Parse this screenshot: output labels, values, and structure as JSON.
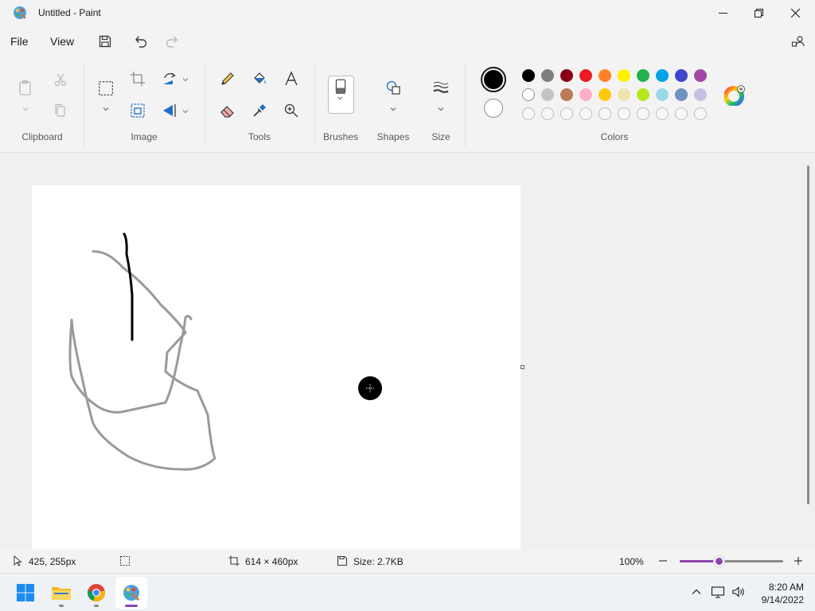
{
  "window": {
    "title": "Untitled - Paint"
  },
  "menu": {
    "file": "File",
    "view": "View"
  },
  "ribbon": {
    "groups": {
      "clipboard": "Clipboard",
      "image": "Image",
      "tools": "Tools",
      "brushes": "Brushes",
      "shapes": "Shapes",
      "size": "Size",
      "colors": "Colors"
    }
  },
  "colors": {
    "color1": "#000000",
    "color2": "#ffffff",
    "palette_row1": [
      "#000000",
      "#7f7f7f",
      "#880015",
      "#ed1c24",
      "#ff7f27",
      "#fff200",
      "#22b14c",
      "#00a2e8",
      "#3f48cc",
      "#a349a4"
    ],
    "palette_row2": [
      "#ffffff",
      "#c3c3c3",
      "#b97a57",
      "#ffaec9",
      "#ffc90e",
      "#efe4b0",
      "#b5e61d",
      "#99d9ea",
      "#7092be",
      "#c8bfe7"
    ],
    "palette_row3_empty_count": 10,
    "accent": "#8e44ad"
  },
  "status": {
    "cursor_position": "425, 255px",
    "canvas_size": "614 × 460px",
    "file_size": "Size: 2.7KB",
    "zoom": "100%",
    "zoom_level_fraction": 0.38
  },
  "taskbar": {
    "apps": [
      "Start",
      "File Explorer",
      "Google Chrome",
      "Paint"
    ],
    "active_app": "Paint",
    "time": "8:20 AM",
    "date": "9/14/2022"
  }
}
